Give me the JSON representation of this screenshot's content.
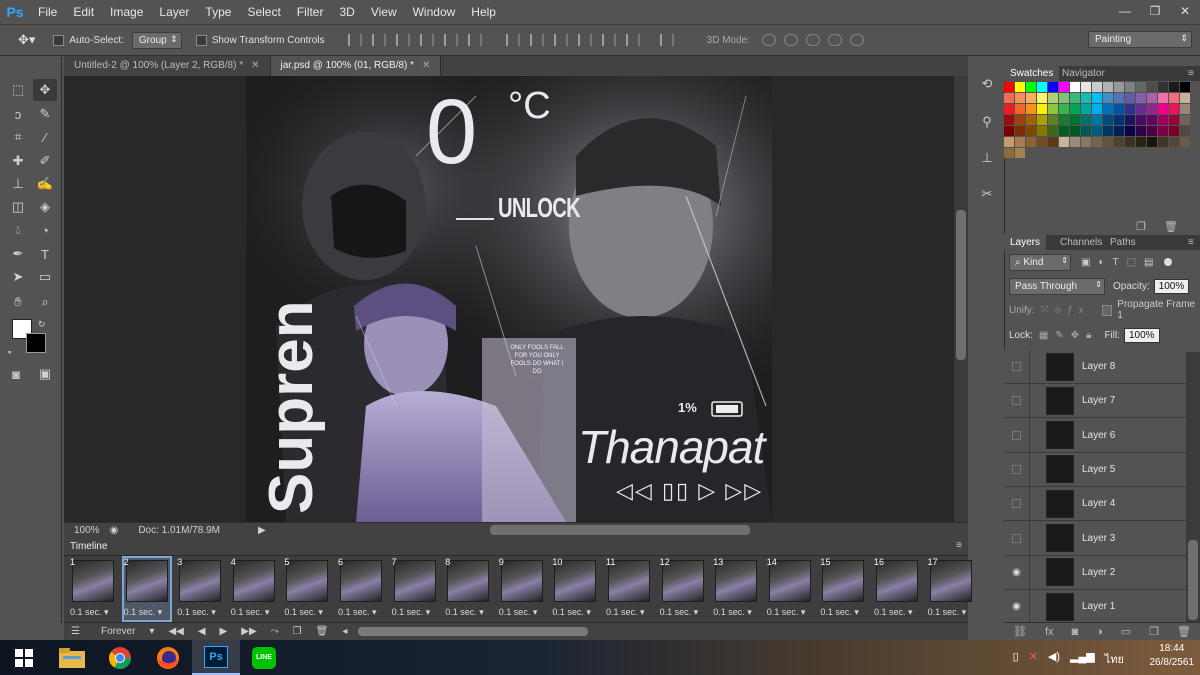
{
  "menu": {
    "app_logo": "Ps",
    "items": [
      "File",
      "Edit",
      "Image",
      "Layer",
      "Type",
      "Select",
      "Filter",
      "3D",
      "View",
      "Window",
      "Help"
    ]
  },
  "options_bar": {
    "auto_select_label": "Auto-Select:",
    "auto_select_value": "Group",
    "show_transform_label": "Show Transform Controls",
    "mode_3d_label": "3D Mode:",
    "workspace": "Painting"
  },
  "doc_tabs": [
    {
      "label": "Untitled-2 @ 100% (Layer 2, RGB/8) *",
      "active": false
    },
    {
      "label": "jar.psd @ 100% (01, RGB/8) *",
      "active": true
    }
  ],
  "artwork": {
    "temp_big": "0",
    "temp_unit": "°C",
    "unlock": "UNLOCK",
    "vertical_word": "Supren",
    "name": "Thanapat",
    "battery": "1%",
    "card_text": "ONLY FOOLS FALL FOR YOU ONLY FOOLS DO WHAT I DO",
    "controls": "◁◁ ▯▯ ▷ ▷▷"
  },
  "status_bar": {
    "zoom": "100%",
    "doc_size": "Doc: 1.01M/78.9M"
  },
  "timeline": {
    "title": "Timeline",
    "loop": "Forever",
    "selected_frame": 2,
    "frames": [
      {
        "num": "1",
        "delay": "0.1 sec."
      },
      {
        "num": "2",
        "delay": "0.1 sec."
      },
      {
        "num": "3",
        "delay": "0.1 sec."
      },
      {
        "num": "4",
        "delay": "0.1 sec."
      },
      {
        "num": "5",
        "delay": "0.1 sec."
      },
      {
        "num": "6",
        "delay": "0.1 sec."
      },
      {
        "num": "7",
        "delay": "0.1 sec."
      },
      {
        "num": "8",
        "delay": "0.1 sec."
      },
      {
        "num": "9",
        "delay": "0.1 sec."
      },
      {
        "num": "10",
        "delay": "0.1 sec."
      },
      {
        "num": "11",
        "delay": "0.1 sec."
      },
      {
        "num": "12",
        "delay": "0.1 sec."
      },
      {
        "num": "13",
        "delay": "0.1 sec."
      },
      {
        "num": "14",
        "delay": "0.1 sec."
      },
      {
        "num": "15",
        "delay": "0.1 sec."
      },
      {
        "num": "16",
        "delay": "0.1 sec."
      },
      {
        "num": "17",
        "delay": "0.1 sec."
      }
    ]
  },
  "swatches_panel": {
    "tabs": [
      "Swatches",
      "Navigator"
    ],
    "colors": [
      "#ff0000",
      "#ffff00",
      "#00ff00",
      "#00ffff",
      "#0000ff",
      "#ff00ff",
      "#ffffff",
      "#e6e6e6",
      "#cccccc",
      "#b3b3b3",
      "#999999",
      "#808080",
      "#666666",
      "#4d4d4d",
      "#333333",
      "#1a1a1a",
      "#000000",
      "#f26c4f",
      "#f68e55",
      "#fbaf5c",
      "#fff467",
      "#acd372",
      "#7cc576",
      "#3bb878",
      "#1abbb4",
      "#00bff3",
      "#438ccb",
      "#5574b9",
      "#605ca8",
      "#855fa8",
      "#a763a8",
      "#f06ea9",
      "#f26d7d",
      "#c7b299",
      "#ed1c24",
      "#f26522",
      "#f7941d",
      "#fff200",
      "#8dc63f",
      "#39b54a",
      "#00a651",
      "#00a99d",
      "#00aeef",
      "#0072bc",
      "#0054a6",
      "#2e3192",
      "#662d91",
      "#92278f",
      "#ec008c",
      "#ed145b",
      "#998675",
      "#9e0b0f",
      "#a0410d",
      "#a3620a",
      "#aba000",
      "#598527",
      "#197b30",
      "#007236",
      "#00746b",
      "#0076a3",
      "#004b80",
      "#003471",
      "#1b1464",
      "#440e62",
      "#630460",
      "#9e005d",
      "#9e0039",
      "#736357",
      "#790000",
      "#7b2e00",
      "#7d4900",
      "#827b00",
      "#406618",
      "#005e20",
      "#005826",
      "#005952",
      "#005b7f",
      "#003663",
      "#002157",
      "#0d004c",
      "#32004b",
      "#4b0049",
      "#7b0046",
      "#7a0026",
      "#534741",
      "#c69c6d",
      "#a67c52",
      "#8c6239",
      "#754c24",
      "#603913",
      "#c4b59d",
      "#9e8b75",
      "#8a7762",
      "#76654f",
      "#62533f",
      "#4e4131",
      "#3b3022",
      "#2a2117",
      "#1c150e",
      "#403529",
      "#544637",
      "#6b5a47",
      "#8b6b3d",
      "#a4824f"
    ]
  },
  "layers_panel": {
    "tabs": [
      "Layers",
      "Channels",
      "Paths"
    ],
    "filter": "Kind",
    "blend_mode": "Pass Through",
    "opacity_label": "Opacity:",
    "opacity": "100%",
    "unify_label": "Unify:",
    "propagate_label": "Propagate Frame 1",
    "lock_label": "Lock:",
    "fill_label": "Fill:",
    "fill": "100%",
    "layers": [
      {
        "name": "Layer 8",
        "visible": false
      },
      {
        "name": "Layer 7",
        "visible": false
      },
      {
        "name": "Layer 6",
        "visible": false
      },
      {
        "name": "Layer 5",
        "visible": false
      },
      {
        "name": "Layer 4",
        "visible": false
      },
      {
        "name": "Layer 3",
        "visible": false
      },
      {
        "name": "Layer 2",
        "visible": true
      },
      {
        "name": "Layer 1",
        "visible": true
      }
    ]
  },
  "taskbar": {
    "time": "18:44",
    "date": "26/8/2561",
    "lang": "ไทย"
  }
}
